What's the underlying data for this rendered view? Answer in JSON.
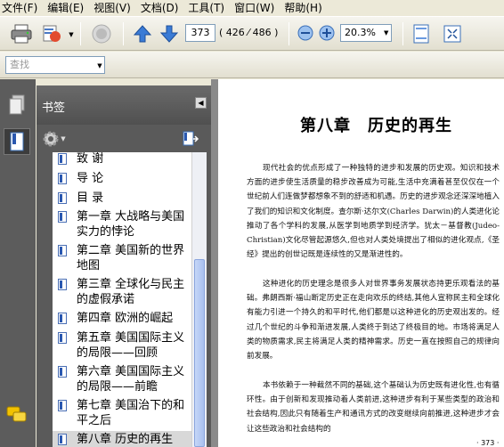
{
  "menu": [
    "文件(F)",
    "编辑(E)",
    "视图(V)",
    "文档(D)",
    "工具(T)",
    "窗口(W)",
    "帮助(H)"
  ],
  "toolbar": {
    "current_page": "373",
    "page_count": "( 426 ⁄ 486 )",
    "zoom": "20.3%"
  },
  "search": {
    "placeholder": "查找"
  },
  "bookmarks": {
    "title": "书签",
    "items": [
      {
        "label": "致 谢"
      },
      {
        "label": "导 论"
      },
      {
        "label": "目 录"
      },
      {
        "label": "第一章 大战略与美国实力的悖论"
      },
      {
        "label": "第二章 美国新的世界地图"
      },
      {
        "label": "第三章 全球化与民主的虚假承诺"
      },
      {
        "label": "第四章 欧洲的崛起"
      },
      {
        "label": "第五章 美国国际主义的局限——回顾"
      },
      {
        "label": "第六章 美国国际主义的局限——前瞻"
      },
      {
        "label": "第七章 美国治下的和平之后"
      },
      {
        "label": "第八章 历史的再生"
      }
    ]
  },
  "document": {
    "chapter_title": "第八章　历史的再生",
    "paragraphs": [
      "现代社会的优点形成了一种独特的进步和发展的历史观。知识和技术方面的进步使生活质量的稳步改善成为可能,生活中充满着甚至仅仅在一个世纪前人们连做梦都想象不到的舒适和机遇。历史的进步观念还深深地植入了我们的知识和文化制度。查尔斯·达尔文(Charles Darwin)的人类进化论推动了各个学科的发展,从医学到地质学到经济学。犹太－基督教(Judeo-Christian)文化尽管起源悠久,但也对人类处境提出了相似的进化观点,《圣经》提出的创世记既是连续性的又是渐进性的。",
      "这种进化的历史理念是很多人对世界事务发展状态持更乐观看法的基础。弗朗西斯·福山断定历史正在走向欢乐的终结,其他人宣称民主和全球化有能力引进一个持久的和平时代,他们都是以这种进化的历史观出发的。经过几个世纪的斗争和渐进发展,人类终于到达了终极目的地。市场将满足人类的物质需求,民主将满足人类的精神需求。历史一直在按照自己的规律向前发展。",
      "本书依赖于一种截然不同的基础,这个基础认为历史既有进化性,也有循环性。由于创新和发现推动着人类前进,这种进步有利于某些类型的政治和社会结构,因此只有随着生产和通讯方式的改变继续向前推进,这种进步才会让这些政治和社会结构的"
    ],
    "page_number": "· 373 ·"
  }
}
